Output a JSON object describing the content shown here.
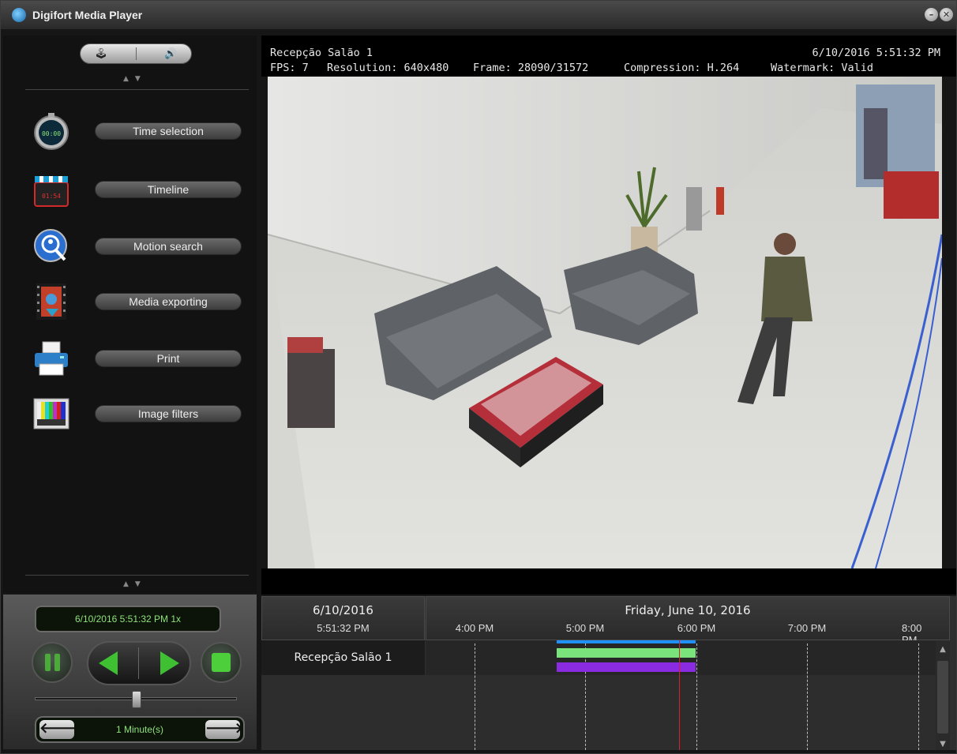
{
  "window": {
    "title": "Digifort Media Player"
  },
  "left_menu": {
    "items": [
      {
        "label": "Time selection",
        "icon": "stopwatch-icon"
      },
      {
        "label": "Timeline",
        "icon": "clapperboard-icon"
      },
      {
        "label": "Motion search",
        "icon": "motion-search-icon"
      },
      {
        "label": "Media exporting",
        "icon": "film-export-icon"
      },
      {
        "label": "Print",
        "icon": "printer-icon"
      },
      {
        "label": "Image filters",
        "icon": "color-bars-icon"
      }
    ]
  },
  "playback": {
    "datetime": "6/10/2016 5:51:32 PM 1x",
    "interval": "1 Minute(s)"
  },
  "video": {
    "camera": "Recepção Salão 1",
    "timestamp": "6/10/2016 5:51:32 PM",
    "fps": "FPS: 7",
    "resolution": "Resolution: 640x480",
    "frame": "Frame: 28090/31572",
    "compression": "Compression: H.264",
    "watermark": "Watermark: Valid"
  },
  "timeline": {
    "date": "6/10/2016",
    "time": "5:51:32 PM",
    "day_title": "Friday, June 10, 2016",
    "ticks": [
      "4:00 PM",
      "5:00 PM",
      "6:00 PM",
      "7:00 PM",
      "8:00 PM"
    ],
    "camera_label": "Recepção Salão 1",
    "colors": {
      "recording_top": "#1e90ff",
      "recording_mid": "#7be37b",
      "recording_bottom": "#8a2be2",
      "cursor": "#d9232b"
    }
  }
}
